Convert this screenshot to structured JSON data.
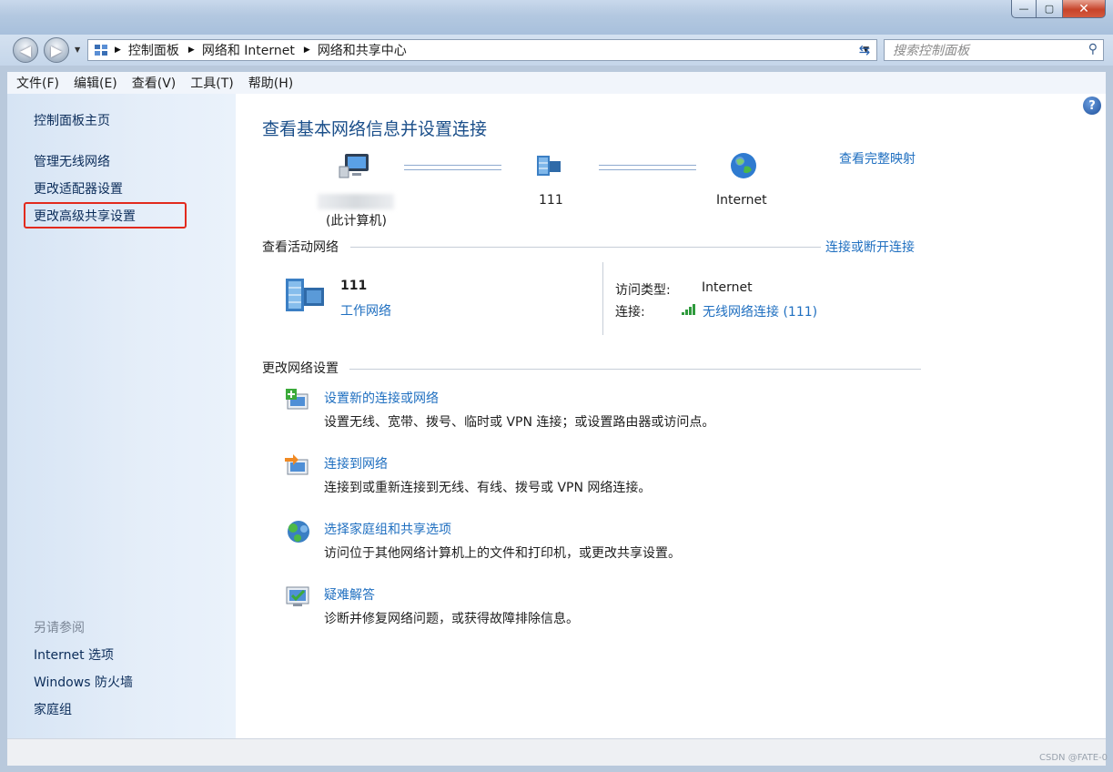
{
  "window": {
    "min_label": "—",
    "max_label": "▢",
    "close_label": "✕"
  },
  "nav": {
    "back_icon": "◀",
    "forward_icon": "▶",
    "breadcrumb": [
      "控制面板",
      "网络和 Internet",
      "网络和共享中心"
    ],
    "search_placeholder": "搜索控制面板"
  },
  "menu": [
    "文件(F)",
    "编辑(E)",
    "查看(V)",
    "工具(T)",
    "帮助(H)"
  ],
  "sidebar": {
    "home": "控制面板主页",
    "items": [
      "管理无线网络",
      "更改适配器设置",
      "更改高级共享设置"
    ],
    "see_also_title": "另请参阅",
    "see_also": [
      "Internet 选项",
      "Windows 防火墙",
      "家庭组"
    ]
  },
  "main": {
    "title": "查看基本网络信息并设置连接",
    "view_full_map": "查看完整映射",
    "map": {
      "this_pc_label": "(此计算机)",
      "network_label": "111",
      "internet_label": "Internet"
    },
    "active": {
      "title": "查看活动网络",
      "connect_link": "连接或断开连接",
      "network_name": "111",
      "network_type": "工作网络",
      "access_type_label": "访问类型:",
      "access_type_value": "Internet",
      "connection_label": "连接:",
      "connection_value": "无线网络连接 (111)"
    },
    "change": {
      "title": "更改网络设置",
      "tasks": [
        {
          "title": "设置新的连接或网络",
          "desc": "设置无线、宽带、拨号、临时或 VPN 连接；或设置路由器或访问点。",
          "icon": "new-connection-icon"
        },
        {
          "title": "连接到网络",
          "desc": "连接到或重新连接到无线、有线、拨号或 VPN 网络连接。",
          "icon": "connect-network-icon"
        },
        {
          "title": "选择家庭组和共享选项",
          "desc": "访问位于其他网络计算机上的文件和打印机，或更改共享设置。",
          "icon": "homegroup-icon"
        },
        {
          "title": "疑难解答",
          "desc": "诊断并修复网络问题，或获得故障排除信息。",
          "icon": "troubleshoot-icon"
        }
      ]
    }
  },
  "watermark": "CSDN @FATE-0"
}
